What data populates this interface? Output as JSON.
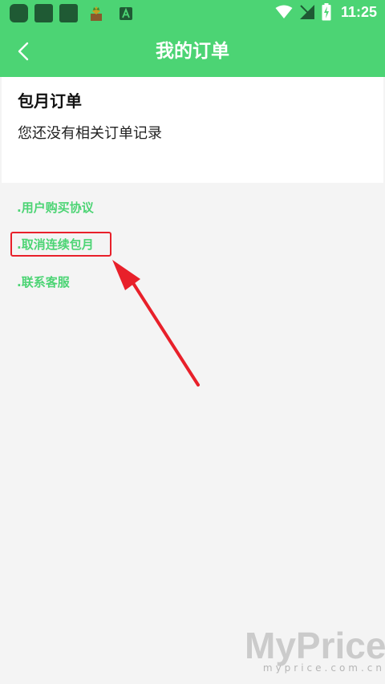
{
  "status_bar": {
    "time": "11:25"
  },
  "header": {
    "title": "我的订单",
    "back_icon": "chevron-left-icon",
    "background_color": "#4cd474"
  },
  "card": {
    "title": "包月订单",
    "empty_message": "您还没有相关订单记录"
  },
  "links": [
    {
      "label": ".用户购买协议"
    },
    {
      "label": ".取消连续包月"
    },
    {
      "label": ".联系客服"
    }
  ],
  "annotation": {
    "box_color": "#e8202a"
  },
  "watermark": {
    "brand": "MyPrice",
    "domain": "myprice.com.cn"
  }
}
